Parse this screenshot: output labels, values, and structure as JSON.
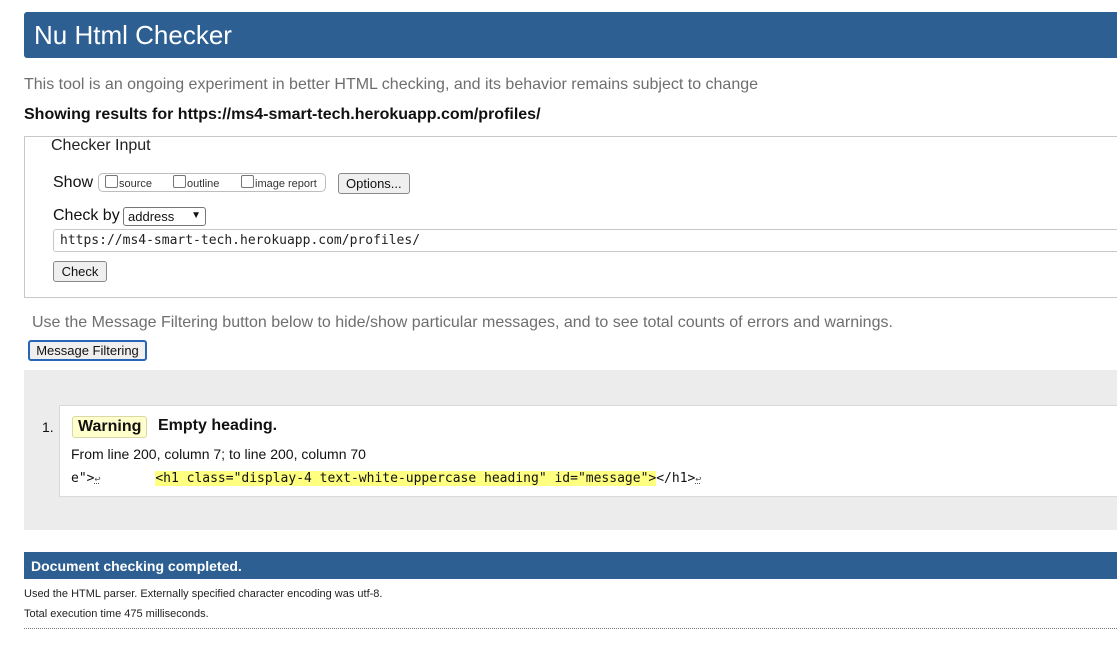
{
  "header": {
    "title": "Nu Html Checker"
  },
  "intro": "This tool is an ongoing experiment in better HTML checking, and its behavior remains subject to change",
  "showing": "Showing results for https://ms4-smart-tech.herokuapp.com/profiles/",
  "checker_input": {
    "legend": "Checker Input",
    "show_label": "Show",
    "options": [
      "source",
      "outline",
      "image report"
    ],
    "options_button": "Options...",
    "check_by_label": "Check by",
    "check_by_value": "address",
    "url": "https://ms4-smart-tech.herokuapp.com/profiles/",
    "check_button": "Check"
  },
  "filtering": {
    "note": "Use the Message Filtering button below to hide/show particular messages, and to see total counts of errors and warnings.",
    "button": "Message Filtering"
  },
  "messages": [
    {
      "number": "1.",
      "type": "Warning",
      "text": "Empty heading.",
      "location": "From line 200, column 7; to line 200, column 70",
      "extract_before": "e\">",
      "extract_highlight": "<h1 class=\"display-4 text-white-uppercase heading\" id=\"message\">",
      "extract_after": "</h1>",
      "linefeed": "↩"
    }
  ],
  "footer": {
    "done": "Document checking completed.",
    "parser_note": "Used the HTML parser. Externally specified character encoding was utf-8.",
    "time_note": "Total execution time 475 milliseconds."
  },
  "colors": {
    "header_bg": "#2d5f92",
    "warning_badge_bg": "#ffffcc",
    "highlight": "#ffff80"
  }
}
